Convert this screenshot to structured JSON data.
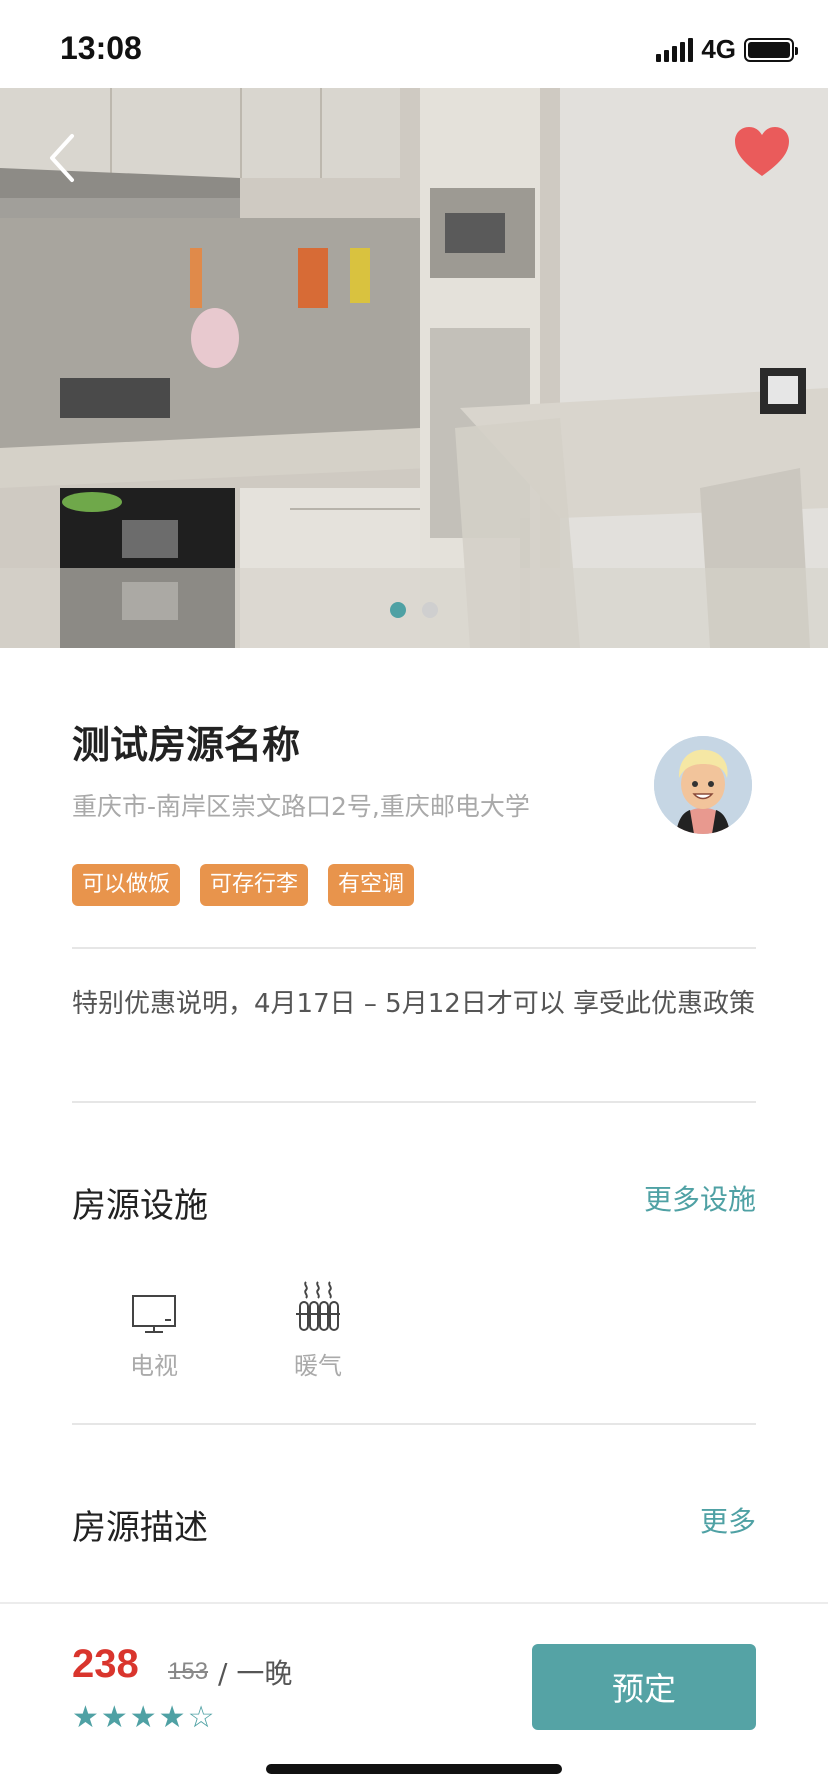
{
  "status_bar": {
    "time": "13:08",
    "network": "4G"
  },
  "listing": {
    "title": "测试房源名称",
    "address": "重庆市-南岸区崇文路口2号,重庆邮电大学",
    "tags": [
      "可以做饭",
      "可存行李",
      "有空调"
    ],
    "promo": "特别优惠说明，4月17日 – 5月12日才可以 享受此优惠政策"
  },
  "gallery": {
    "current_page": 1,
    "total_pages": 2
  },
  "facilities": {
    "title": "房源设施",
    "more_label": "更多设施",
    "items": [
      {
        "label": "电视",
        "icon": "tv-icon"
      },
      {
        "label": "暖气",
        "icon": "heater-icon"
      }
    ]
  },
  "description": {
    "title": "房源描述",
    "more_label": "更多"
  },
  "booking": {
    "price": "238",
    "original_price": "153",
    "per_night": "/ 一晚",
    "rating_filled": 4,
    "rating_max": 5,
    "stars_text": "★★★★☆",
    "book_label": "预定"
  },
  "colors": {
    "accent": "#55a3a5",
    "tag": "#e8944c",
    "price": "#d9352d",
    "favorite": "#ea5b5b"
  }
}
